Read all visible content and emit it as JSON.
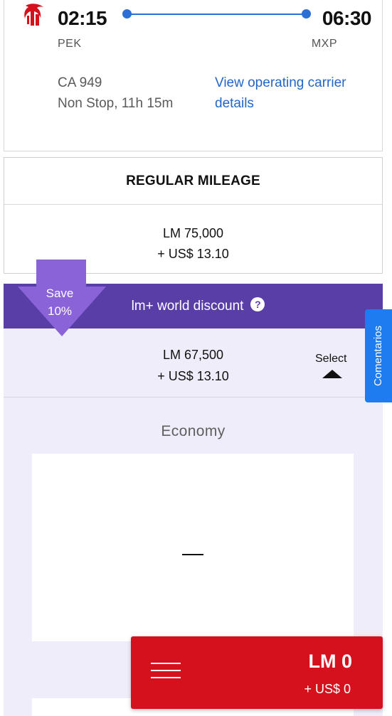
{
  "flight": {
    "departure_time": "02:15",
    "arrival_time": "06:30",
    "origin_code": "PEK",
    "destination_code": "MXP",
    "flight_number": "CA 949",
    "duration": "Non Stop, 11h 15m",
    "carrier_link": "View operating carrier details"
  },
  "regular": {
    "title": "REGULAR MILEAGE",
    "miles": "LM 75,000",
    "fees": "+ US$ 13.10"
  },
  "discount": {
    "save_label": "Save",
    "save_percent": "10%",
    "title": "lm+ world discount",
    "help_icon": "?",
    "miles": "LM 67,500",
    "fees": "+ US$ 13.10",
    "select_label": "Select"
  },
  "cabin": {
    "title": "Economy",
    "value": "—"
  },
  "side_tab": {
    "label": "Comentarios"
  },
  "summary": {
    "miles": "LM 0",
    "fees": "+ US$ 0"
  },
  "colors": {
    "brand_red": "#d6111e",
    "link_blue": "#2466c7",
    "discount_purple": "#5a3ea8",
    "badge_purple": "#8a63d8",
    "tab_blue": "#1f7cf0",
    "panel_lavender": "#efedf9"
  },
  "icons": [
    "airline-logo",
    "help-icon",
    "caret-up-icon",
    "menu-icon"
  ]
}
